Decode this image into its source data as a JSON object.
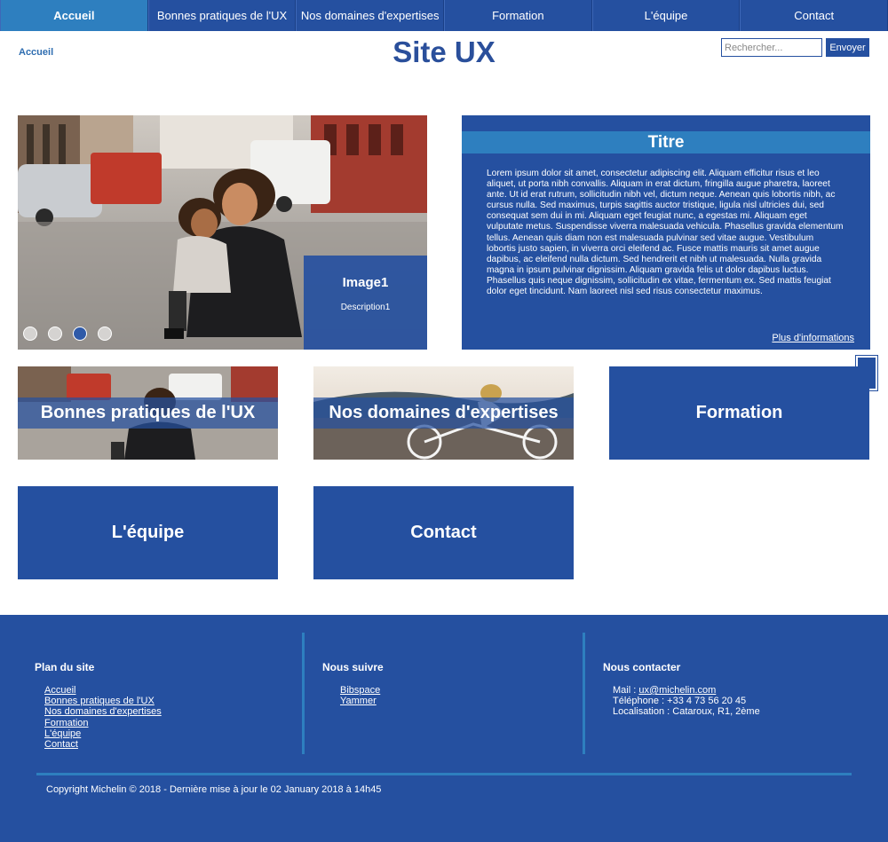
{
  "nav": {
    "items": [
      {
        "label": "Accueil",
        "active": true
      },
      {
        "label": "Bonnes pratiques de l'UX",
        "active": false
      },
      {
        "label": "Nos domaines d'expertises",
        "active": false
      },
      {
        "label": "Formation",
        "active": false
      },
      {
        "label": "L'équipe",
        "active": false
      },
      {
        "label": "Contact",
        "active": false
      }
    ]
  },
  "header": {
    "breadcrumb": "Accueil",
    "title": "Site UX",
    "search_placeholder": "Rechercher...",
    "search_button": "Envoyer"
  },
  "carousel": {
    "caption_title": "Image1",
    "caption_description": "Description1",
    "slide_count": 4,
    "active_slide": 3
  },
  "info": {
    "title": "Titre",
    "body": "Lorem ipsum dolor sit amet, consectetur adipiscing elit. Aliquam efficitur risus et leo aliquet, ut porta nibh convallis. Aliquam in erat dictum, fringilla augue pharetra, laoreet ante. Ut id erat rutrum, sollicitudin nibh vel, dictum neque. Aenean quis lobortis nibh, ac cursus nulla. Sed maximus, turpis sagittis auctor tristique, ligula nisl ultricies dui, sed consequat sem dui in mi. Aliquam eget feugiat nunc, a egestas mi. Aliquam eget vulputate metus. Suspendisse viverra malesuada vehicula. Phasellus gravida elementum tellus. Aenean quis diam non est malesuada pulvinar sed vitae augue. Vestibulum lobortis justo sapien, in viverra orci eleifend ac. Fusce mattis mauris sit amet augue dapibus, ac eleifend nulla dictum. Sed hendrerit et nibh ut malesuada. Nulla gravida magna in ipsum pulvinar dignissim. Aliquam gravida felis ut dolor dapibus luctus. Phasellus quis neque dignissim, sollicitudin ex vitae, fermentum ex. Sed mattis feugiat dolor eget tincidunt. Nam laoreet nisl sed risus consectetur maximus.",
    "more_link": "Plus d'informations"
  },
  "scroll_top_icon": "↑",
  "tiles": [
    {
      "label": "Bonnes pratiques de l'UX",
      "image": true
    },
    {
      "label": "Nos domaines d'expertises",
      "image": true
    },
    {
      "label": "Formation",
      "image": false
    },
    {
      "label": "L'équipe",
      "image": false
    },
    {
      "label": "Contact",
      "image": false
    }
  ],
  "footer": {
    "sitemap": {
      "title": "Plan du site",
      "links": [
        "Accueil",
        "Bonnes pratiques de l'UX",
        "Nos domaines d'expertises",
        "Formation",
        "L'équipe",
        "Contact"
      ]
    },
    "follow": {
      "title": "Nous suivre",
      "links": [
        "Bibspace",
        "Yammer"
      ]
    },
    "contact": {
      "title": "Nous contacter",
      "mail_label": "Mail : ",
      "mail": "ux@michelin.com",
      "phone": "Téléphone : +33 4 73 56 20 45",
      "location": "Localisation : Cataroux, R1, 2ème"
    },
    "copyright": "Copyright Michelin © 2018 - Dernière mise à jour le 02 January 2018 à 14h45"
  },
  "colors": {
    "primary": "#2550a0",
    "accent": "#2e7fbf",
    "title": "#2a4f9b"
  }
}
